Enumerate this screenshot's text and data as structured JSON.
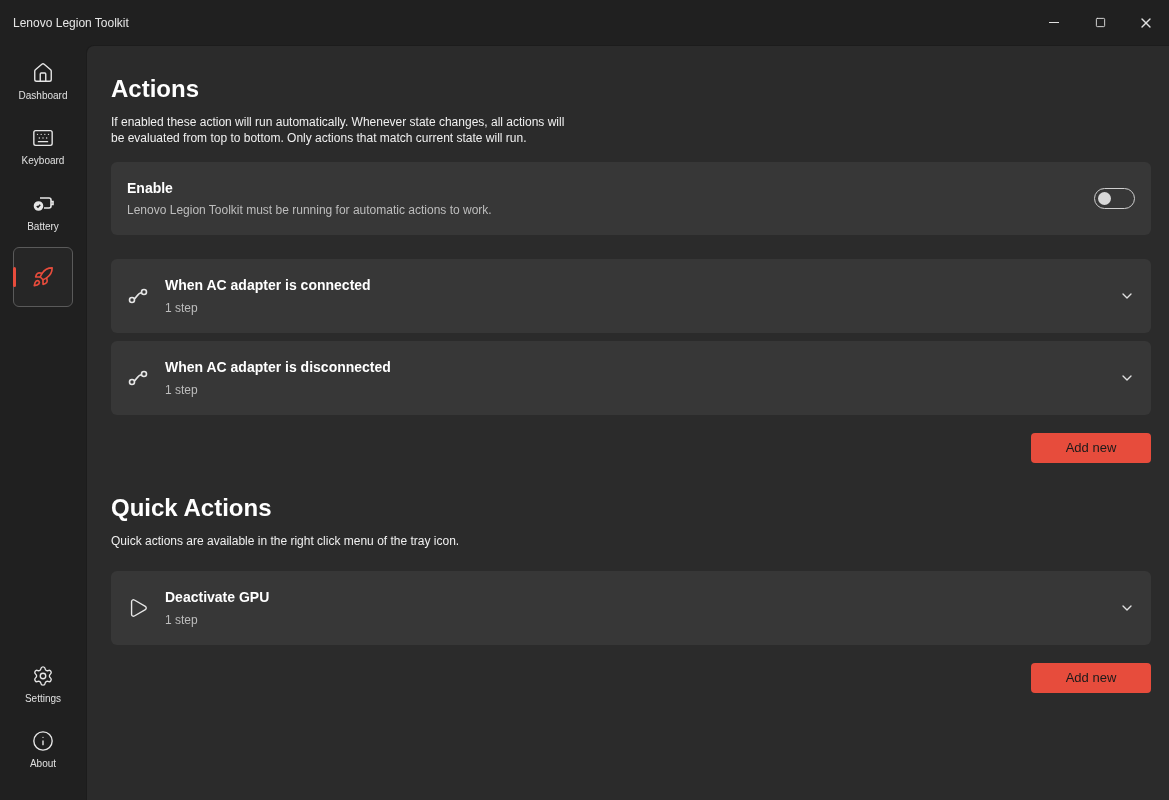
{
  "window": {
    "title": "Lenovo Legion Toolkit"
  },
  "sidebar": {
    "items": [
      {
        "label": "Dashboard",
        "kind": "home",
        "selected": false
      },
      {
        "label": "Keyboard",
        "kind": "keyboard",
        "selected": false
      },
      {
        "label": "Battery",
        "kind": "battery",
        "selected": false
      },
      {
        "kind": "rocket",
        "selected": true
      }
    ],
    "footer_items": [
      {
        "label": "Settings",
        "kind": "settings",
        "selected": false
      },
      {
        "label": "About",
        "kind": "about",
        "selected": false
      }
    ]
  },
  "sections": [
    {
      "title": "Actions",
      "description": "If enabled these action will run automatically. Whenever state changes, all actions will be evaluated from top to bottom. Only actions that match current state will run.",
      "setting": {
        "title": "Enable",
        "subtitle": "Lenovo Legion Toolkit must be running for automatic actions to work.",
        "on": false
      },
      "items": [
        {
          "kind": "trigger",
          "title": "When AC adapter is connected",
          "subtitle": "1 step",
          "expanded": false
        },
        {
          "kind": "trigger",
          "title": "When AC adapter is disconnected",
          "subtitle": "1 step",
          "expanded": false
        }
      ],
      "button": "Add new"
    },
    {
      "title": "Quick Actions",
      "description": "Quick actions are available in the right click menu of the tray icon.",
      "items": [
        {
          "kind": "play",
          "title": "Deactivate GPU",
          "subtitle": "1 step",
          "expanded": false
        }
      ],
      "button": "Add new"
    }
  ]
}
